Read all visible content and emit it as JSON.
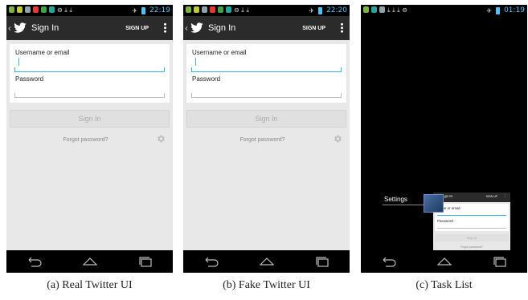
{
  "panels": [
    {
      "status_time": "22:19",
      "app_title": "Sign In",
      "signup_label": "SIGN UP",
      "username_label": "Username or email",
      "password_label": "Password",
      "signin_button": "Sign In",
      "forgot_link": "Forgot password?",
      "caption": "(a) Real Twitter UI"
    },
    {
      "status_time": "22:20",
      "app_title": "Sign In",
      "signup_label": "SIGN UP",
      "username_label": "Username or email",
      "password_label": "Password",
      "signin_button": "Sign In",
      "forgot_link": "Forgot password?",
      "caption": "(b) Fake Twitter UI"
    },
    {
      "status_time": "01:19",
      "task_label": "Settings",
      "mini": {
        "title": "gn In",
        "signup": "SIGN UP",
        "username_label": "name or email",
        "password_label": "Password",
        "signin_button": "Sign In",
        "forgot_link": "Forgot password?"
      },
      "caption": "(c) Task List"
    }
  ],
  "colors": {
    "accent": "#33b5e5",
    "actionbar": "#2b2b2b",
    "background": "#e8e8e8",
    "status_time": "#4fc3f7"
  },
  "icons": [
    "back-arrow-icon",
    "twitter-bird-icon",
    "overflow-menu-icon",
    "gear-icon",
    "nav-back-icon",
    "nav-home-icon",
    "nav-recents-icon"
  ]
}
